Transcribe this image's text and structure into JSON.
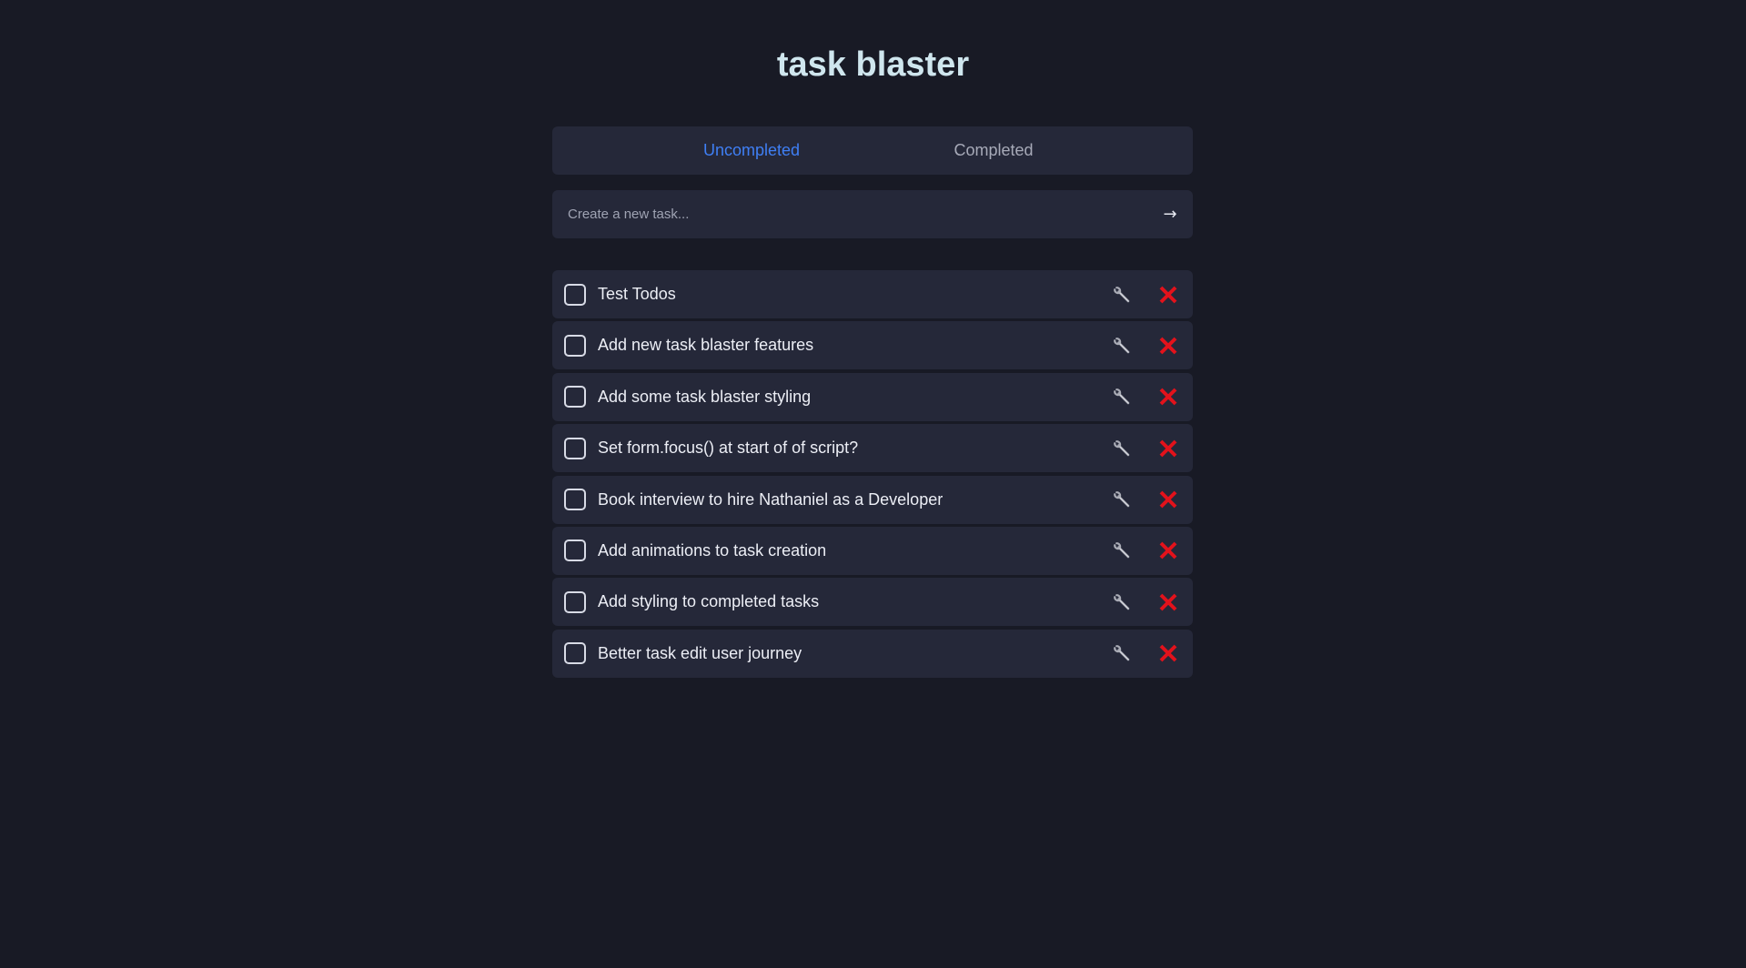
{
  "app": {
    "title": "task blaster"
  },
  "tabs": [
    {
      "label": "Uncompleted",
      "active": true
    },
    {
      "label": "Completed",
      "active": false
    }
  ],
  "new_task": {
    "placeholder": "Create a new task...",
    "value": "",
    "submit_icon": "arrow-right-icon",
    "submit_glyph": "→"
  },
  "tasks": [
    {
      "label": "Test Todos",
      "completed": false
    },
    {
      "label": "Add new task blaster features",
      "completed": false
    },
    {
      "label": "Add some task blaster styling",
      "completed": false
    },
    {
      "label": "Set form.focus() at start of of script?",
      "completed": false
    },
    {
      "label": "Book interview to hire Nathaniel as a Developer",
      "completed": false
    },
    {
      "label": "Add animations to task creation",
      "completed": false
    },
    {
      "label": "Add styling to completed tasks",
      "completed": false
    },
    {
      "label": "Better task edit user journey",
      "completed": false
    }
  ],
  "icons": {
    "edit": "wrench-icon",
    "delete": "close-icon"
  },
  "colors": {
    "background": "#181a25",
    "panel": "#252839",
    "title": "#cfe6ee",
    "active_tab": "#3f7ff5",
    "inactive_tab": "#a7aab8",
    "delete": "#e3121b",
    "wrench": "#a9abb5"
  }
}
